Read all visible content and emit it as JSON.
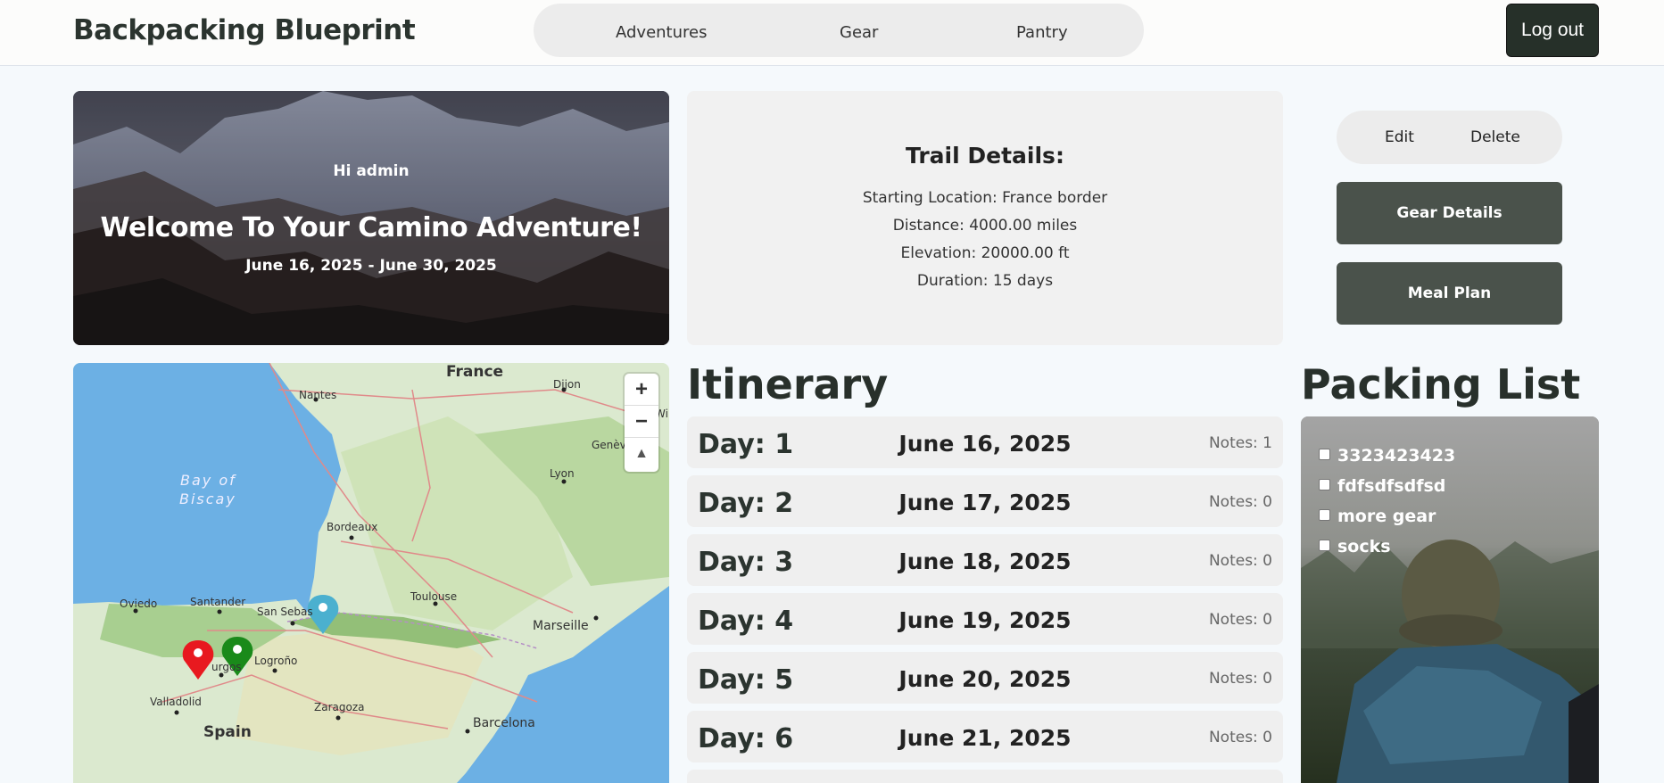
{
  "nav": {
    "brand": "Backpacking Blueprint",
    "links": [
      "Adventures",
      "Gear",
      "Pantry"
    ],
    "logout": "Log out"
  },
  "hero": {
    "greeting": "Hi admin",
    "title": "Welcome To Your Camino Adventure!",
    "dates": "June 16, 2025 - June 30, 2025"
  },
  "trail": {
    "heading": "Trail Details:",
    "starting_location": "Starting Location: France border",
    "distance": "Distance: 4000.00 miles",
    "elevation": "Elevation: 20000.00 ft",
    "duration": "Duration: 15 days"
  },
  "actions": {
    "edit": "Edit",
    "delete": "Delete",
    "gear_details": "Gear Details",
    "meal_plan": "Meal Plan"
  },
  "map": {
    "zoom_in": "+",
    "zoom_out": "−",
    "reset_north": "▲",
    "labels": {
      "france": "France",
      "spain": "Spain",
      "nantes": "Nantes",
      "dijon": "Dijon",
      "lyon": "Lyon",
      "geneve": "Genève",
      "bay": "Bay of",
      "biscay": "Biscay",
      "bordeaux": "Bordeaux",
      "toulouse": "Toulouse",
      "marseille": "Marseille",
      "oviedo": "Oviedo",
      "santander": "Santander",
      "san_sebastian": "San Sebas",
      "burgos": "urgos",
      "logrono": "Logroño",
      "valladolid": "Valladolid",
      "zaragoza": "Zaragoza",
      "barcelona": "Barcelona",
      "wi": "Wi"
    },
    "marker_colors": {
      "red": "#e8191f",
      "green": "#1a8a1a",
      "blue": "#4bb0cf"
    }
  },
  "itinerary": {
    "title": "Itinerary",
    "days": [
      {
        "label": "Day: 1",
        "date": "June 16, 2025",
        "notes": "Notes: 1"
      },
      {
        "label": "Day: 2",
        "date": "June 17, 2025",
        "notes": "Notes: 0"
      },
      {
        "label": "Day: 3",
        "date": "June 18, 2025",
        "notes": "Notes: 0"
      },
      {
        "label": "Day: 4",
        "date": "June 19, 2025",
        "notes": "Notes: 0"
      },
      {
        "label": "Day: 5",
        "date": "June 20, 2025",
        "notes": "Notes: 0"
      },
      {
        "label": "Day: 6",
        "date": "June 21, 2025",
        "notes": "Notes: 0"
      }
    ]
  },
  "packing": {
    "title": "Packing List",
    "items": [
      "3323423423",
      "fdfsdfsdfsd",
      "more gear",
      "socks"
    ]
  },
  "colors": {
    "primary_dark": "#263029",
    "button_green": "#4a524b",
    "card_bg": "#f1f1f1"
  }
}
